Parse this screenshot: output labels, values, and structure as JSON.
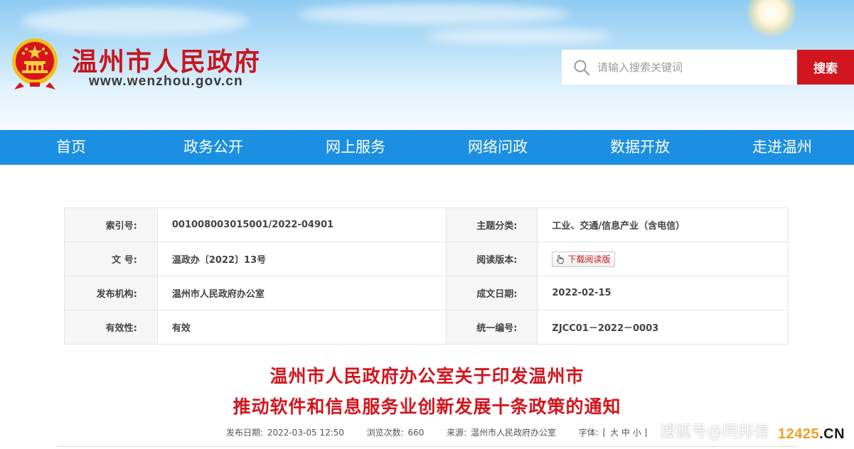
{
  "header": {
    "site_name": "温州市人民政府",
    "site_domain": "www.wenzhou.gov.cn",
    "search_placeholder": "请输入搜索关键词",
    "search_button": "搜索"
  },
  "nav": {
    "items": [
      "首页",
      "政务公开",
      "网上服务",
      "网络问政",
      "数据开放",
      "走进温州"
    ]
  },
  "info": {
    "index_label": "索引号:",
    "index_value": "001008003015001/2022-04901",
    "topic_label": "主题分类:",
    "topic_value": "工业、交通/信息产业（含电信）",
    "docno_label": "文 号:",
    "docno_value": "温政办〔2022〕13号",
    "version_label": "阅读版本:",
    "download_label": "下载阅读版",
    "issuer_label": "发布机构:",
    "issuer_value": "温州市人民政府办公室",
    "date_label": "成文日期:",
    "date_value": "2022-02-15",
    "validity_label": "有效性:",
    "validity_value": "有效",
    "serial_label": "统一编号:",
    "serial_value": "ZJCC01－2022－0003"
  },
  "article": {
    "title_line1": "温州市人民政府办公室关于印发温州市",
    "title_line2": "推动软件和信息服务业创新发展十条政策的通知"
  },
  "meta": {
    "publish_label": "发布日期:",
    "publish_value": "2022-03-05 12:50",
    "views_label": "浏览次数:",
    "views_value": "660",
    "source_label": "来源:",
    "source_value": "温州市人民政府办公室",
    "font_label": "字体:",
    "font_open": "[",
    "font_large": "大",
    "font_medium": "中",
    "font_small": "小",
    "font_close": "]"
  },
  "watermark": {
    "text": "搜狐号@同邦信",
    "site_num": "12425",
    "site_tld": ".CN"
  },
  "colors": {
    "brand_red": "#d1161f",
    "nav_blue": "#1b8fe2"
  }
}
